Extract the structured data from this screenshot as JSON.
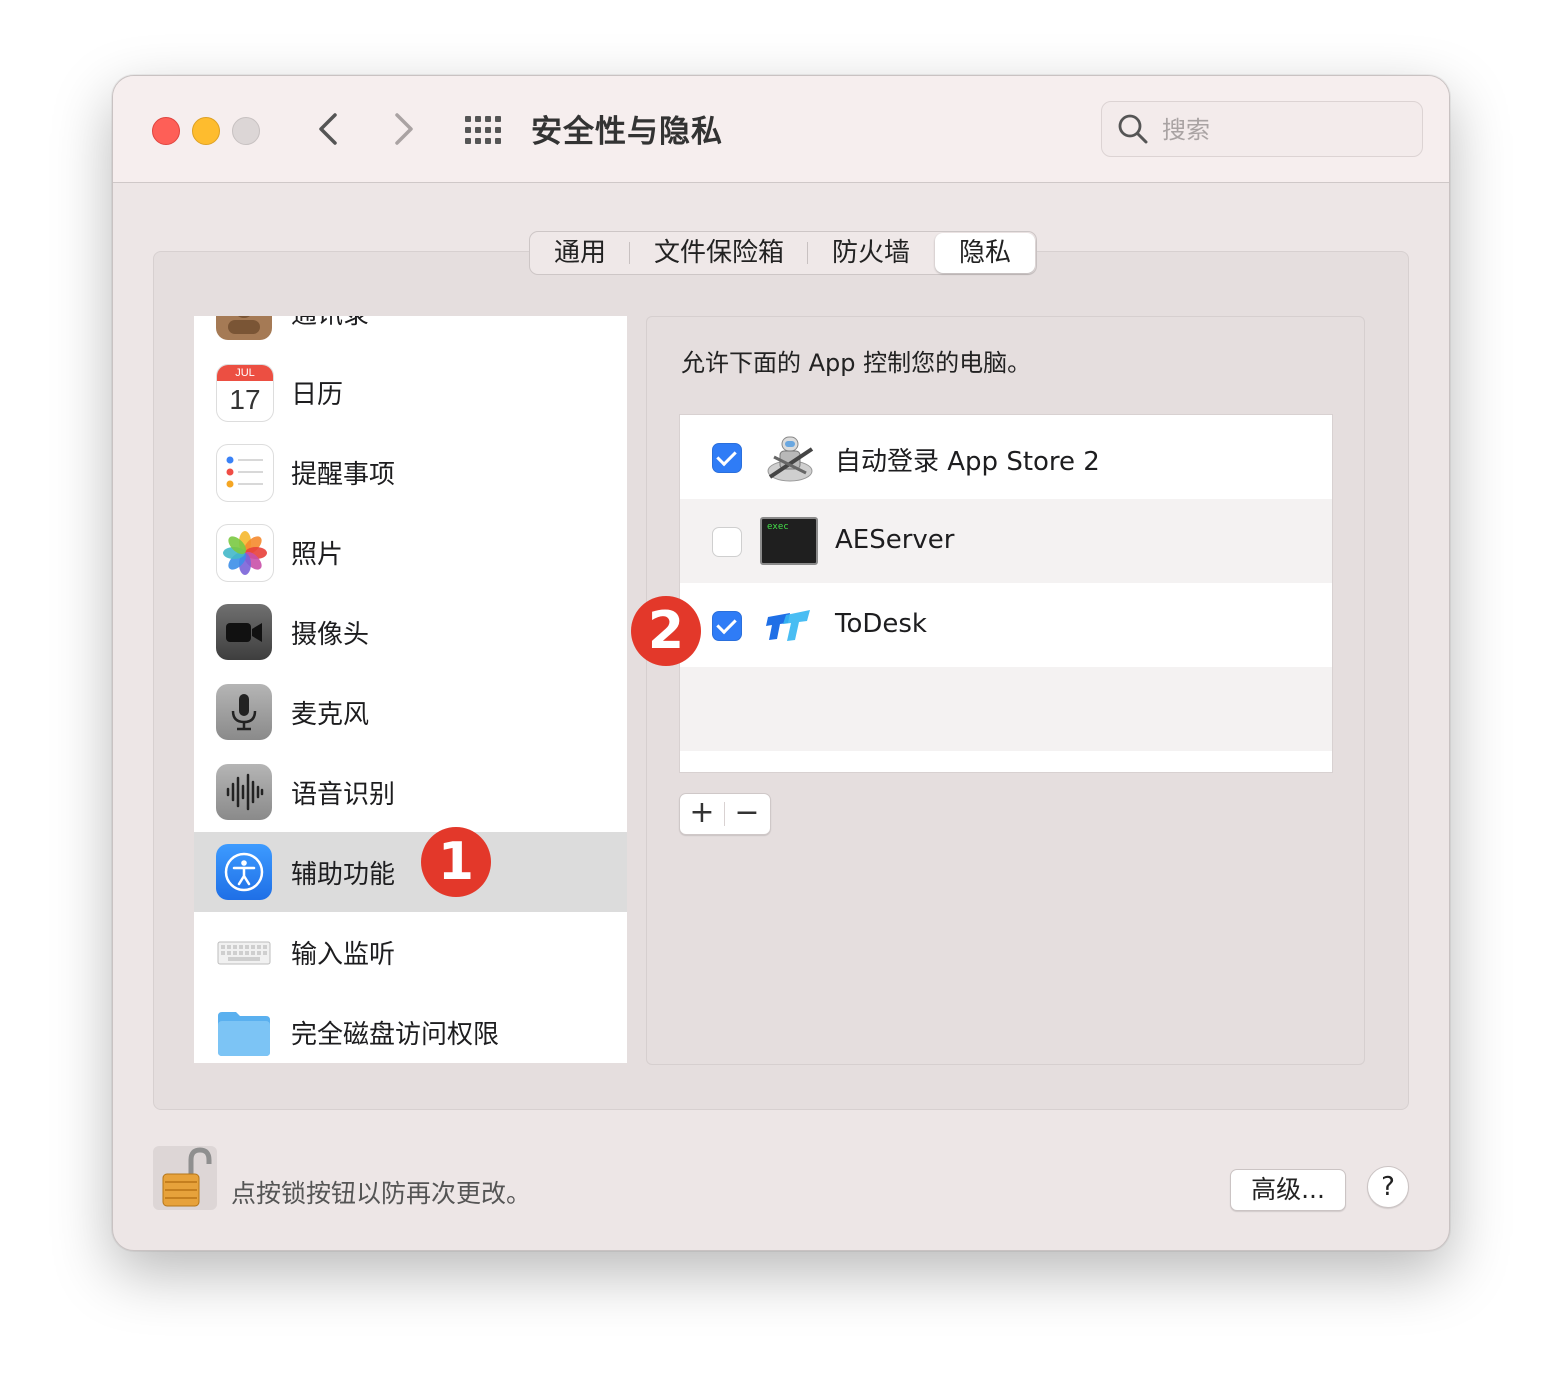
{
  "window": {
    "title": "安全性与隐私",
    "search_placeholder": "搜索"
  },
  "nav": {
    "back": "‹",
    "forward": "›"
  },
  "tabs": [
    {
      "label": "通用",
      "active": false
    },
    {
      "label": "文件保险箱",
      "active": false
    },
    {
      "label": "防火墙",
      "active": false
    },
    {
      "label": "隐私",
      "active": true
    }
  ],
  "sidebar": {
    "items": [
      {
        "label": "通讯录",
        "icon": "contacts-icon"
      },
      {
        "label": "日历",
        "icon": "calendar-icon",
        "calendar_month": "JUL",
        "calendar_day": "17"
      },
      {
        "label": "提醒事项",
        "icon": "reminders-icon"
      },
      {
        "label": "照片",
        "icon": "photos-icon"
      },
      {
        "label": "摄像头",
        "icon": "camera-icon"
      },
      {
        "label": "麦克风",
        "icon": "microphone-icon"
      },
      {
        "label": "语音识别",
        "icon": "speech-recognition-icon"
      },
      {
        "label": "辅助功能",
        "icon": "accessibility-icon",
        "selected": true
      },
      {
        "label": "输入监听",
        "icon": "keyboard-icon"
      },
      {
        "label": "完全磁盘访问权限",
        "icon": "folder-icon"
      }
    ]
  },
  "markers": {
    "one": "1",
    "two": "2",
    "color": "#e3382a"
  },
  "detail": {
    "description": "允许下面的 App 控制您的电脑。",
    "apps": [
      {
        "name": "自动登录 App Store 2",
        "checked": true,
        "icon": "automator-icon"
      },
      {
        "name": "AEServer",
        "checked": false,
        "icon": "exec-terminal-icon",
        "icon_text": "exec"
      },
      {
        "name": "ToDesk",
        "checked": true,
        "icon": "todesk-icon"
      }
    ],
    "add_label": "+",
    "remove_label": "−"
  },
  "footer": {
    "lock_text": "点按锁按钮以防再次更改。",
    "advanced_label": "高级...",
    "help_label": "?"
  },
  "colors": {
    "accent": "#2f7cf6",
    "window_bg": "#ede6e6",
    "selection": "#dcdcdc"
  }
}
